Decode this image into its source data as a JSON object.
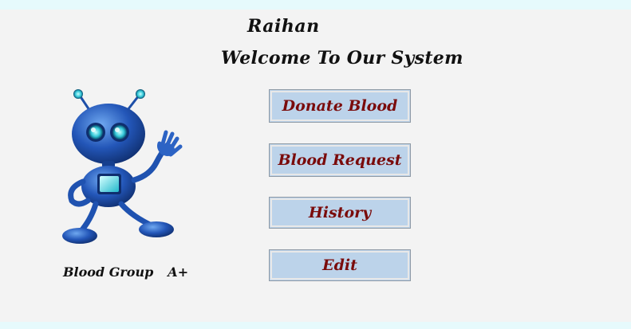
{
  "header": {
    "username": "Raihan",
    "welcome": "Welcome To Our System"
  },
  "menu": {
    "donate_label": "Donate Blood",
    "request_label": "Blood Request",
    "history_label": "History",
    "edit_label": "Edit"
  },
  "profile": {
    "blood_group_label": "Blood Group",
    "blood_group_value": "A+",
    "avatar_icon": "robot-icon"
  },
  "colors": {
    "button_bg": "#bcd3ea",
    "button_text": "#7a0b0b",
    "panel_bg": "#f3f3f3",
    "window_bg": "#e6fafc"
  }
}
